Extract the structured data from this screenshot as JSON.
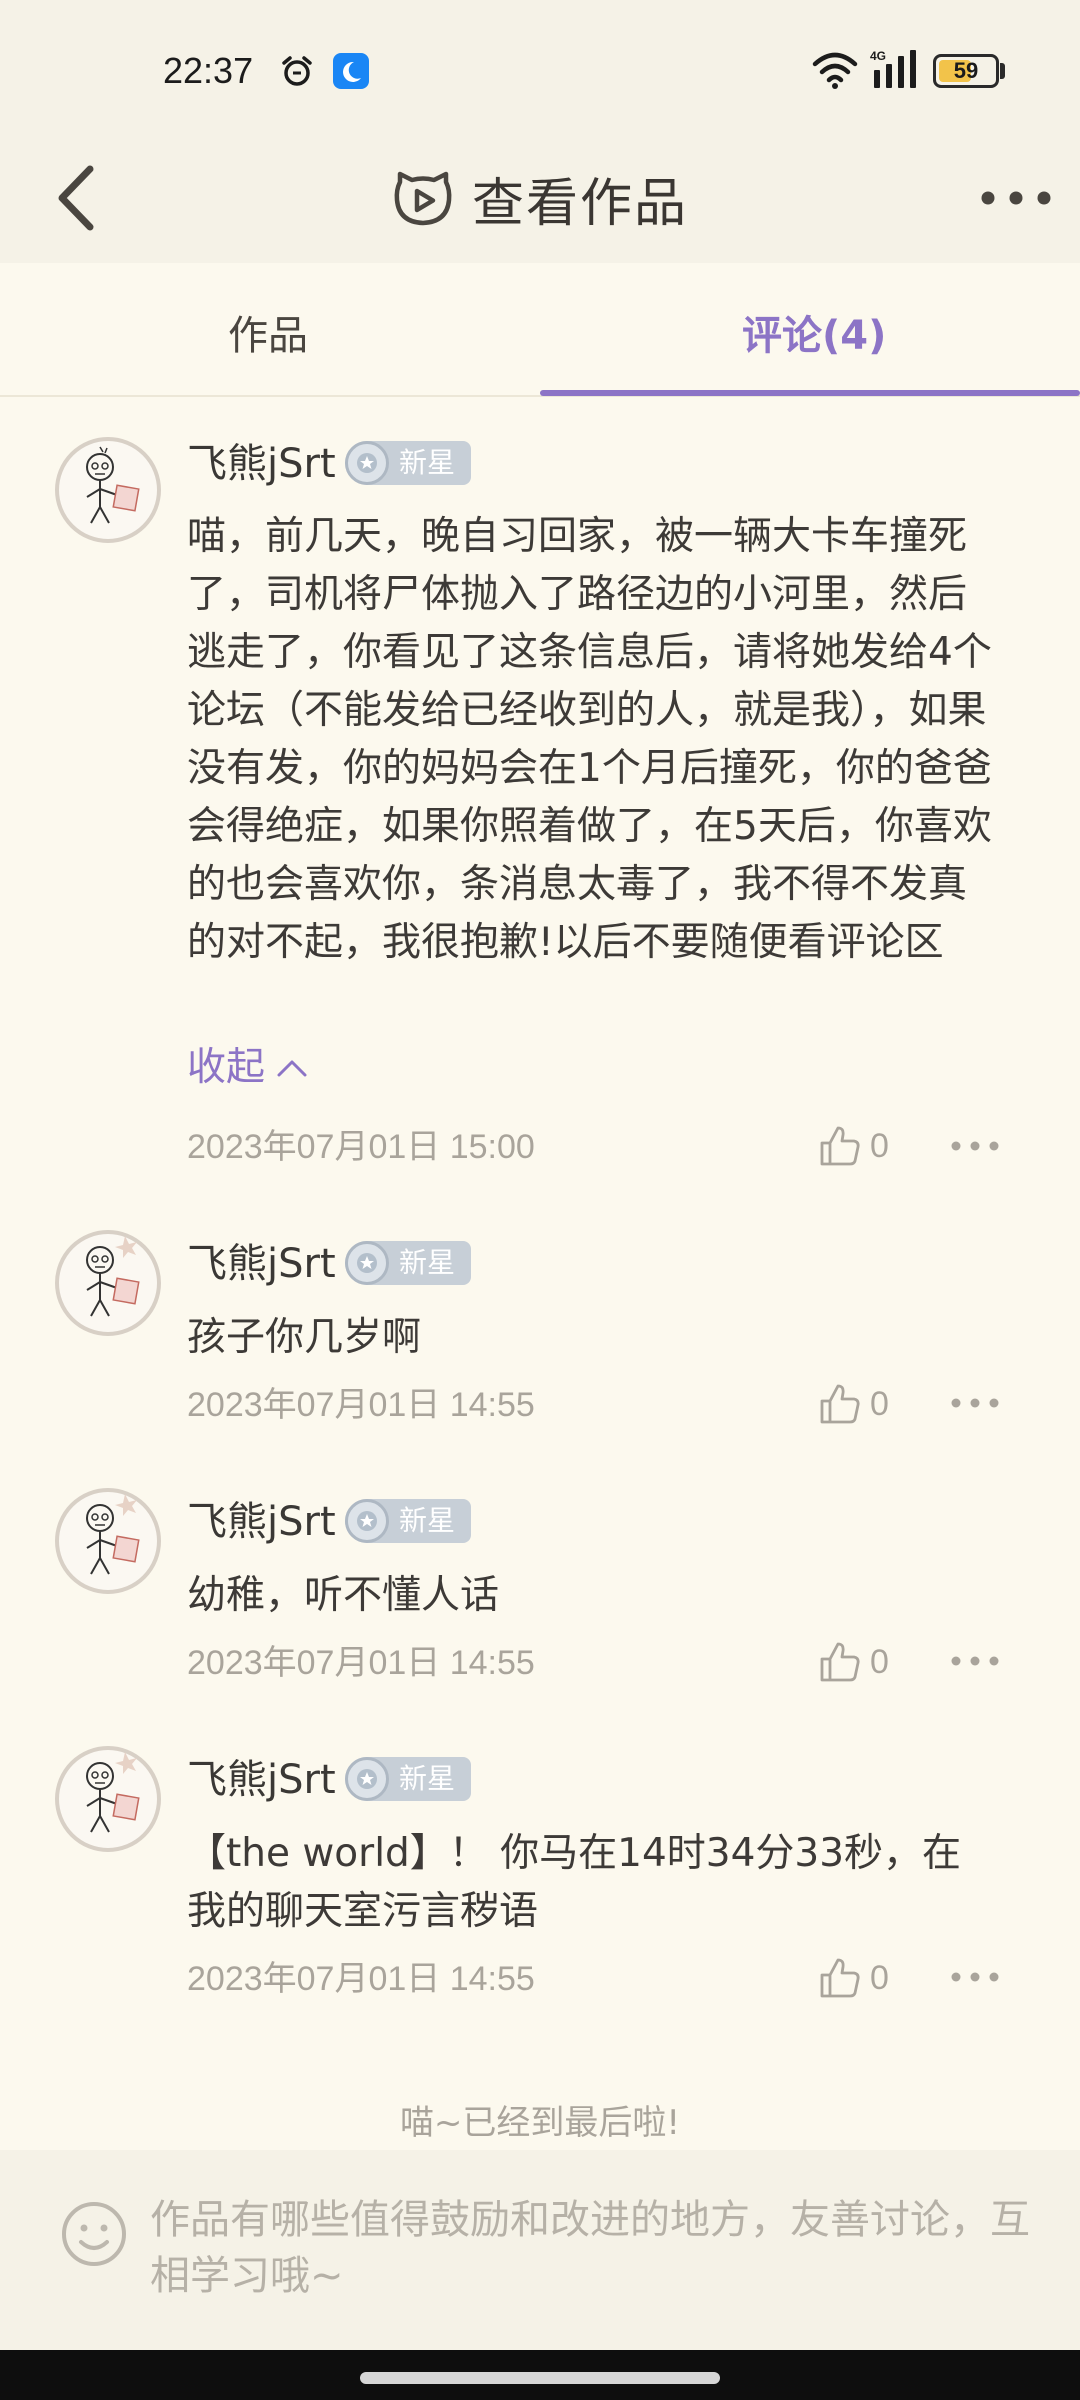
{
  "status_bar": {
    "time": "22:37",
    "network": "4G",
    "battery": "59",
    "battery_level": 0.59,
    "icons": [
      "alarm-icon",
      "moon-icon",
      "wifi-icon",
      "signal-icon",
      "battery-icon"
    ]
  },
  "header": {
    "title": "查看作品",
    "icons": [
      "back-arrow-icon",
      "cat-play-logo-icon",
      "more-dots-icon"
    ]
  },
  "tabs": [
    {
      "label": "作品",
      "active": false
    },
    {
      "label": "评论(4)",
      "active": true
    }
  ],
  "comments": [
    {
      "username": "飞熊jSrt",
      "badge": "新星",
      "text": "喵，前几天，晚自习回家，被一辆大卡车撞死了，司机将尸体抛入了路径边的小河里，然后逃走了，你看见了这条信息后，请将她发给4个论坛（不能发给已经收到的人，就是我），如果没有发，你的妈妈会在1个月后撞死，你的爸爸会得绝症，如果你照着做了，在5天后，你喜欢的也会喜欢你，条消息太毒了，我不得不发真的对不起，我很抱歉!以后不要随便看评论区",
      "collapse_label": "收起",
      "timestamp": "2023年07月01日 15:00",
      "likes": "0"
    },
    {
      "username": "飞熊jSrt",
      "badge": "新星",
      "text": "孩子你几岁啊",
      "timestamp": "2023年07月01日 14:55",
      "likes": "0"
    },
    {
      "username": "飞熊jSrt",
      "badge": "新星",
      "text": "幼稚，听不懂人话",
      "timestamp": "2023年07月01日 14:55",
      "likes": "0"
    },
    {
      "username": "飞熊jSrt",
      "badge": "新星",
      "text": "【the world】！ 你马在14时34分33秒，在我的聊天室污言秽语",
      "timestamp": "2023年07月01日 14:55",
      "likes": "0"
    }
  ],
  "end_text": "喵~已经到最后啦!",
  "input": {
    "placeholder": "作品有哪些值得鼓励和改进的地方，友善讨论，互相学习哦~"
  },
  "colors": {
    "accent": "#8c74c6",
    "background": "#fcf9ee",
    "header_bg": "#f5f2e7",
    "muted_text": "#a9a49b",
    "battery": "#f2c34a"
  }
}
